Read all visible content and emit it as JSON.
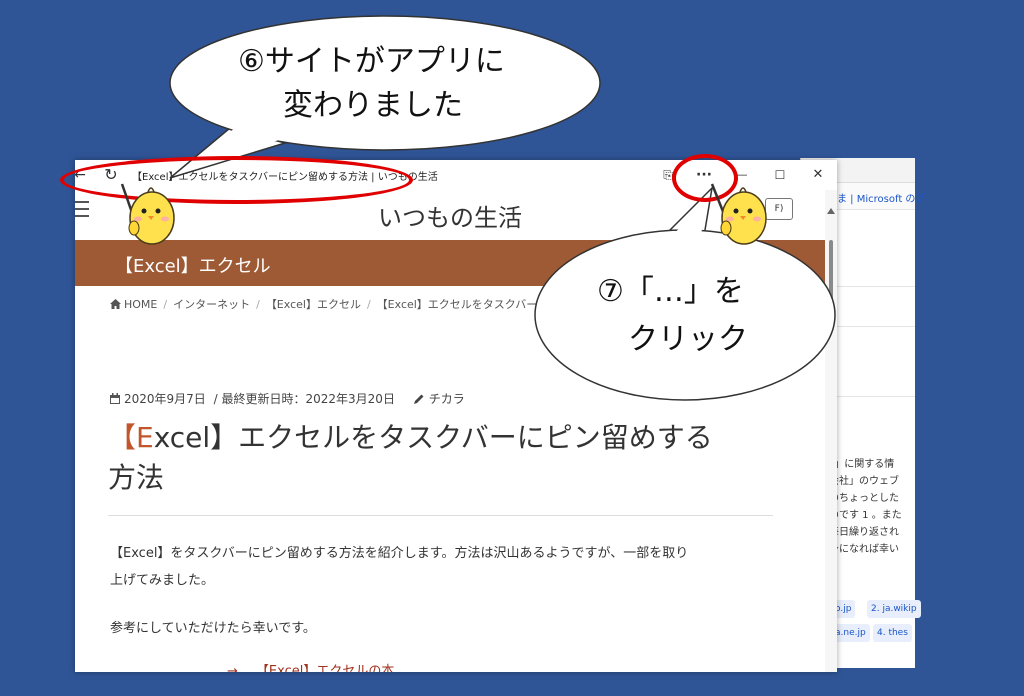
{
  "annotations": {
    "step6_line1": "⑥サイトがアプリに",
    "step6_line2": "変わりました",
    "step7_line1": "⑦「…」を",
    "step7_line2": "クリック"
  },
  "app_window": {
    "title": "【Excel】エクセルをタスクバーにピン留めする方法 | いつもの生活",
    "more_label": "···",
    "minimize_label": "—",
    "maximize_label": "☐",
    "close_label": "✕",
    "back_label": "←",
    "refresh_label": "↻",
    "share_label": "⎘"
  },
  "site": {
    "title": "いつもの生活",
    "header_button_label": "F)",
    "category": "【Excel】エクセル"
  },
  "breadcrumb": {
    "home": "HOME",
    "item1": "インターネット",
    "item2": "【Excel】エクセル",
    "item3": "【Excel】エクセルをタスクバー"
  },
  "article": {
    "date": "2020年9月7日",
    "updated": "/ 最終更新日時：2022年3月20日",
    "author": "チカラ",
    "title_accent": "【E",
    "title_rest": "xcel】エクセルをタスクバーにピン留めする",
    "title_line2": "方法",
    "para1_line1": "【Excel】をタスクバーにピン留めする方法を紹介します。方法は沢山あるようですが、一部を取り",
    "para1_line2": "上げてみました。",
    "para2": "参考にしていただけたら幸いです。",
    "link_arrow": "→",
    "link_text": "【Excel】エクセルの本"
  },
  "background_window": {
    "bookmark_text": "ま | Microsoft のブ",
    "lines": [
      "s」に関する情",
      "会社」のウェブ",
      "のちょっとした",
      "のです 1 。また",
      "毎日繰り返され",
      "身になれば幸い"
    ],
    "chips": [
      "o.jp",
      "2. ja.wikip",
      "a.ne.jp",
      "4. thes"
    ]
  }
}
